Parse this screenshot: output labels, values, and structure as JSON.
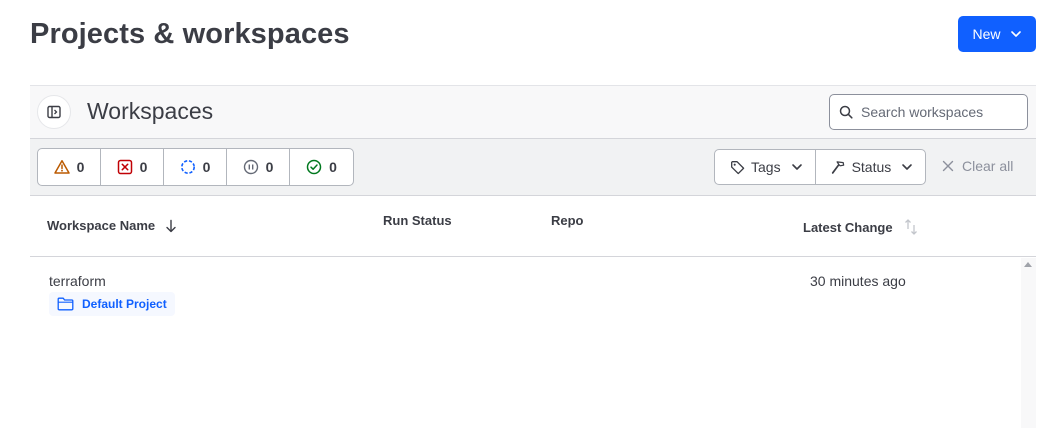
{
  "page": {
    "title": "Projects & workspaces"
  },
  "header": {
    "new_label": "New",
    "accent": "#1060ff"
  },
  "panel": {
    "title": "Workspaces",
    "search_placeholder": "Search workspaces"
  },
  "status_counts": [
    {
      "icon": "warning-icon",
      "count": "0",
      "color": "#bb5a00"
    },
    {
      "icon": "error-icon",
      "count": "0",
      "color": "#c00005"
    },
    {
      "icon": "running-icon",
      "count": "0",
      "color": "#1060ff"
    },
    {
      "icon": "paused-icon",
      "count": "0",
      "color": "#656a76"
    },
    {
      "icon": "success-icon",
      "count": "0",
      "color": "#00781e"
    }
  ],
  "filters": {
    "tags_label": "Tags",
    "status_label": "Status",
    "clear_label": "Clear all"
  },
  "table": {
    "columns": {
      "name": "Workspace Name",
      "run_status": "Run Status",
      "repo": "Repo",
      "latest_change": "Latest Change"
    },
    "rows": [
      {
        "name": "terraform",
        "project": "Default Project",
        "latest_change": "30 minutes ago"
      }
    ]
  }
}
